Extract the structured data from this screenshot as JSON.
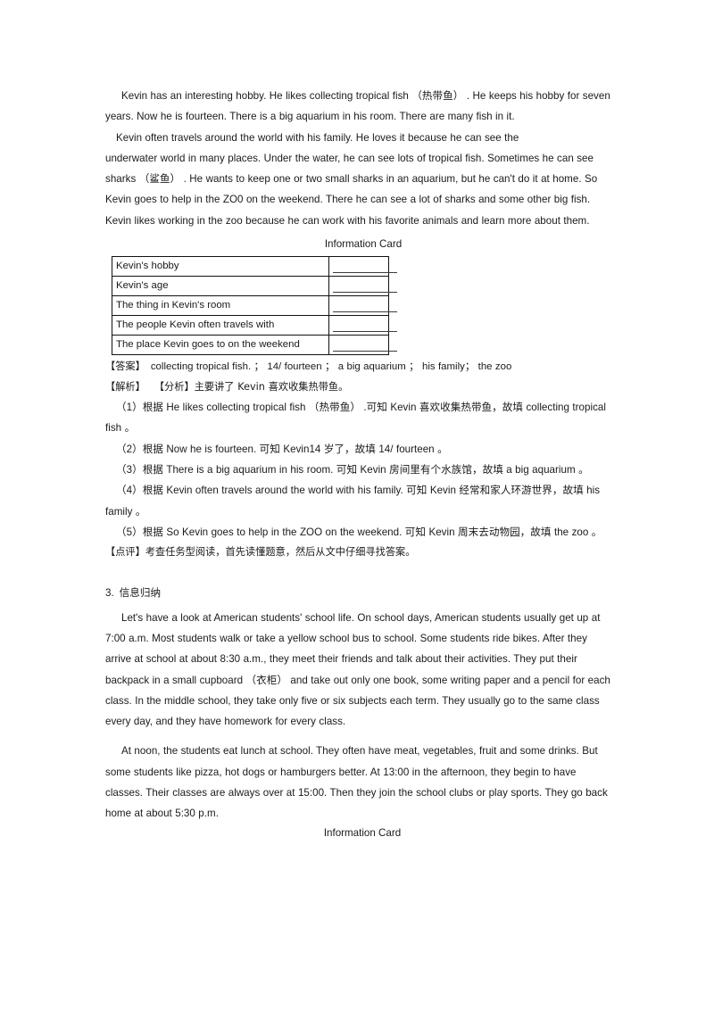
{
  "document": {
    "passage1": {
      "paragraph1": "Kevin has an interesting hobby. He likes collecting tropical fish （热带鱼） . He keeps his hobby for seven years. Now he is fourteen. There is a big aquarium in his room. There are many fish in it.",
      "paragraph2_line1": "Kevin often  travels around the  world  with  his family. He loves it because he can see the",
      "paragraph2_rest": "underwater world in many places. Under the water, he can see lots of tropical fish. Sometimes he can see sharks （鲨鱼） . He wants to keep one or two small sharks in an aquarium, but he can't do it at home. So Kevin goes to help in the ZO0 on the weekend. There he can see a lot of sharks and some other big fish. Kevin likes working in the zoo because he can work with his favorite animals and learn more about them."
    },
    "card1": {
      "caption": "Information Card",
      "rows": [
        {
          "label": "Kevin's   hobby",
          "blank": ""
        },
        {
          "label": "Kevin's   age",
          "blank": ""
        },
        {
          "label": "The   thing in Kevin's room",
          "blank": ""
        },
        {
          "label": "The   people Kevin often travels with",
          "blank": ""
        },
        {
          "label": "The     place Kevin goes to on the weekend",
          "blank": ""
        }
      ]
    },
    "answer_block1": {
      "answer_label": "【答案】",
      "answer_text": "collecting tropical fish. ；  14/ fourteen ；   a big aquarium ；   his family；   the zoo",
      "analysis_label": "【解析】",
      "analysis_sub_label": "【分析】",
      "analysis_text": "主要讲了 Kevin 喜欢收集热带鱼。",
      "items": [
        "（1）根据 He likes collecting  tropical  fish  （热带鱼） .可知 Kevin 喜欢收集热带鱼，故填 collecting tropical fish 。",
        "（2）根据 Now he is fourteen. 可知 Kevin14 岁了，故填   14/ fourteen 。",
        "（3）根据 There is a big aquarium      in his room. 可知 Kevin 房间里有个水族馆，故填       a big aquarium 。",
        "（4）根据 Kevin often travels around the world with his family.       可知 Kevin 经常和家人环游世界，故填 his family 。",
        "（5）根据 So Kevin goes to help in the ZOO on the weekend. 可知 Kevin 周末去动物园，故填 the zoo 。"
      ],
      "comment_label": "【点评】",
      "comment_text": "考查任务型阅读，首先读懂题意，然后从文中仔细寻找答案。"
    },
    "section3": {
      "number": "3.",
      "title": "信息归纳",
      "paragraph1": "Let's have a look at American students' school life. On school days, American students usually get up at 7:00 a.m. Most students walk or take a yellow school bus to school. Some students ride bikes. After they arrive at school at about 8:30 a.m., they meet their friends and talk about their activities. They put their backpack in a small cupboard （衣柜） and take out only one book, some writing paper and a pencil for each class. In the middle school, they take only five or six subjects each term. They usually go to the same class every day, and they have homework for every class.",
      "paragraph2": "At noon, the students eat lunch at school. They often have meat, vegetables, fruit and some drinks. But some students like pizza, hot dogs or hamburgers better. At 13:00 in the afternoon, they begin to have classes. Their classes are always over at 15:00. Then they join the school clubs or play sports. They go back home at about 5:30 p.m."
    },
    "card2": {
      "caption": "Information Card"
    }
  }
}
